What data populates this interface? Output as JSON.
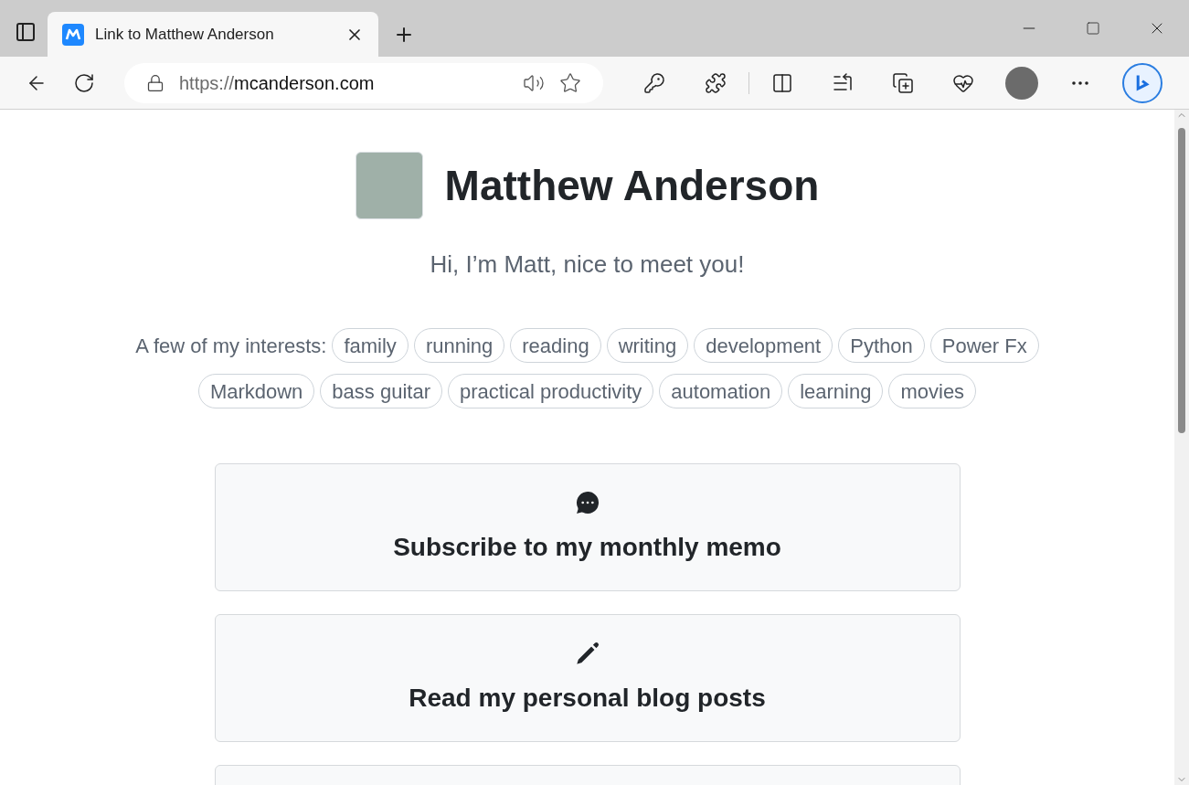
{
  "browser": {
    "tab": {
      "title": "Link to Matthew Anderson",
      "selected": true
    },
    "address": {
      "scheme": "https://",
      "host": "mcanderson.com"
    }
  },
  "profile": {
    "name": "Matthew Anderson",
    "tagline": "Hi, I’m Matt, nice to meet you!"
  },
  "interests": {
    "label": "A few of my interests:",
    "tags": [
      "family",
      "running",
      "reading",
      "writing",
      "development",
      "Python",
      "Power Fx",
      "Markdown",
      "bass guitar",
      "practical productivity",
      "automation",
      "learning",
      "movies"
    ]
  },
  "cards": [
    {
      "kind": "memo",
      "title": "Subscribe to my monthly memo"
    },
    {
      "kind": "blog",
      "title": "Read my personal blog posts"
    },
    {
      "kind": "cut"
    }
  ]
}
